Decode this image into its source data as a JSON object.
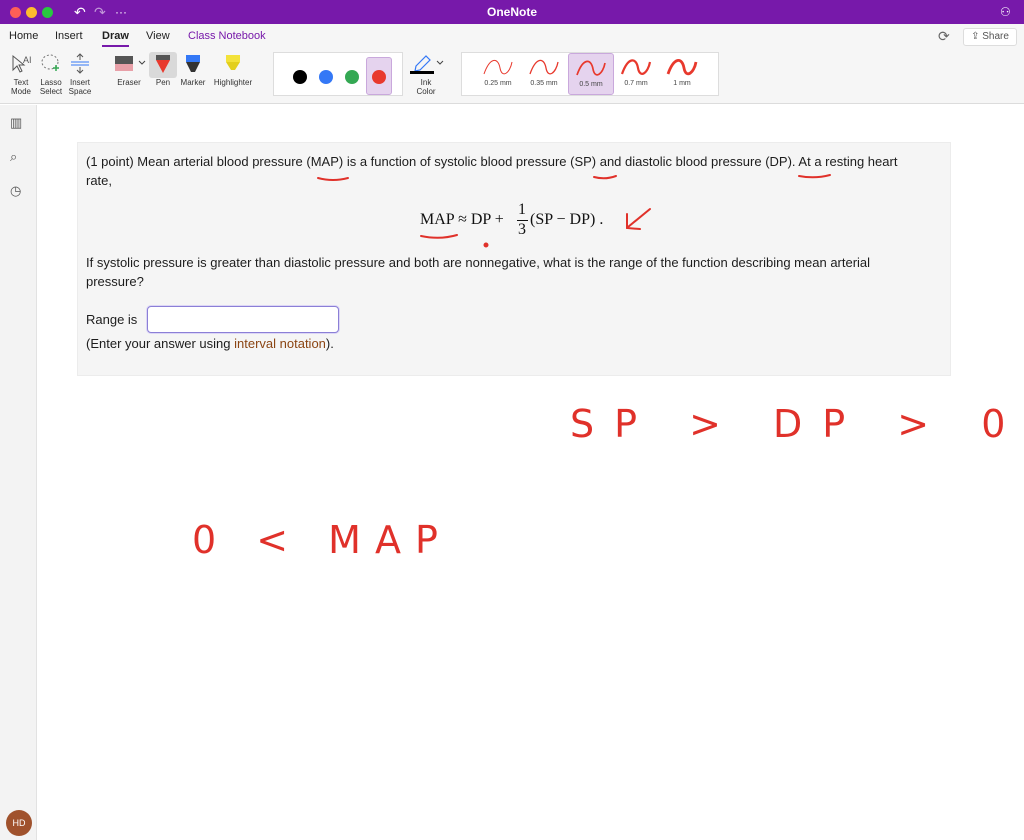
{
  "window": {
    "title": "OneNote"
  },
  "titlebar": {
    "undo_icon": "undo-icon",
    "redo_icon": "redo-icon",
    "more_icon": "more-icon",
    "collab_icon": "people-icon"
  },
  "menu": {
    "tabs": [
      {
        "label": "Home"
      },
      {
        "label": "Insert"
      },
      {
        "label": "Draw"
      },
      {
        "label": "View"
      },
      {
        "label": "Class Notebook"
      }
    ],
    "active_tab": "Draw",
    "share_label": "Share"
  },
  "ribbon": {
    "text_mode": [
      "Text",
      "Mode"
    ],
    "lasso": [
      "Lasso",
      "Select"
    ],
    "insert_space": [
      "Insert",
      "Space"
    ],
    "eraser": "Eraser",
    "pen": "Pen",
    "marker": "Marker",
    "highlighter": "Highlighter",
    "ink_color": [
      "Ink",
      "Color"
    ],
    "colors": [
      {
        "name": "black",
        "hex": "#000000"
      },
      {
        "name": "blue",
        "hex": "#3478f6"
      },
      {
        "name": "green",
        "hex": "#34a853"
      },
      {
        "name": "red",
        "hex": "#e8392d"
      }
    ],
    "selected_color": "red",
    "widths": [
      "0.25 mm",
      "0.35 mm",
      "0.5 mm",
      "0.7 mm",
      "1 mm"
    ],
    "selected_width": "0.5 mm"
  },
  "sidebar": {
    "icons": [
      "notebooks-icon",
      "search-icon",
      "recent-icon"
    ],
    "avatar_initials": "HD"
  },
  "problem": {
    "line1": "(1 point) Mean arterial blood pressure (MAP) is a function of systolic blood pressure (SP) and diastolic blood pressure (DP). At a resting heart",
    "line2": "rate,",
    "formula_lhs": "MAP ≈ DP +",
    "frac_num": "1",
    "frac_den": "3",
    "formula_rhs": "(SP − DP) .",
    "question_line1": "If systolic pressure is greater than diastolic pressure and both are nonnegative, what is the range of the function describing mean arterial",
    "question_line2": "pressure?",
    "range_label": "Range is",
    "range_value": "",
    "hint_prefix": "(Enter your answer using ",
    "hint_link": "interval notation",
    "hint_suffix": ")."
  },
  "ink_notes": {
    "color": "#e0312a",
    "note1": "SP > DP  > 0",
    "note2": "0 < MAP"
  }
}
